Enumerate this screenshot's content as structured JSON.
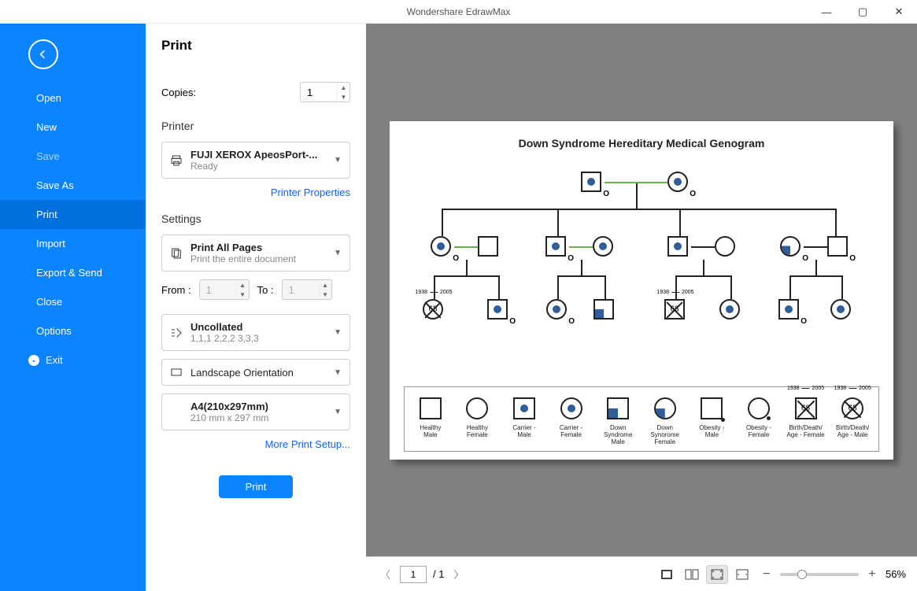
{
  "app": {
    "title": "Wondershare EdrawMax"
  },
  "sidebar": {
    "items": [
      "Open",
      "New",
      "Save",
      "Save As",
      "Print",
      "Import",
      "Export & Send",
      "Close",
      "Options"
    ],
    "exit": "Exit",
    "active_index": 4,
    "dim_index": 2
  },
  "panel": {
    "heading": "Print",
    "copies_label": "Copies:",
    "copies_value": "1",
    "printer_label": "Printer",
    "printer_name": "FUJI XEROX ApeosPort-...",
    "printer_status": "Ready",
    "printer_props_link": "Printer Properties",
    "settings_label": "Settings",
    "pages_title": "Print All Pages",
    "pages_sub": "Print the entire document",
    "from_label": "From :",
    "from_value": "1",
    "to_label": "To :",
    "to_value": "1",
    "collate_title": "Uncollated",
    "collate_sub": "1,1,1   2,2,2   3,3,3",
    "orientation": "Landscape Orientation",
    "paper_title": "A4(210x297mm)",
    "paper_sub": "210 mm x 297 mm",
    "more_link": "More Print Setup...",
    "print_btn": "Print"
  },
  "preview": {
    "doc_title": "Down Syndrome Hereditary Medical Genogram",
    "year_a": "1938",
    "year_b": "2005",
    "age": "68",
    "legend": [
      {
        "label": "Healthy\nMale"
      },
      {
        "label": "Healthy\nFemale"
      },
      {
        "label": "Carrier -\nMale"
      },
      {
        "label": "Carrier -\nFemale"
      },
      {
        "label": "Down\nSyndrome\nMale"
      },
      {
        "label": "Down\nSynorome\nFemale"
      },
      {
        "label": "Obesity -\nMale"
      },
      {
        "label": "Obesity -\nFemale"
      },
      {
        "label": "Birth/Death/\nAge - Female"
      },
      {
        "label": "Birth/Death/\nAge - Male"
      }
    ],
    "footer": {
      "page_current": "1",
      "page_total": "1",
      "zoom": "56%"
    }
  }
}
